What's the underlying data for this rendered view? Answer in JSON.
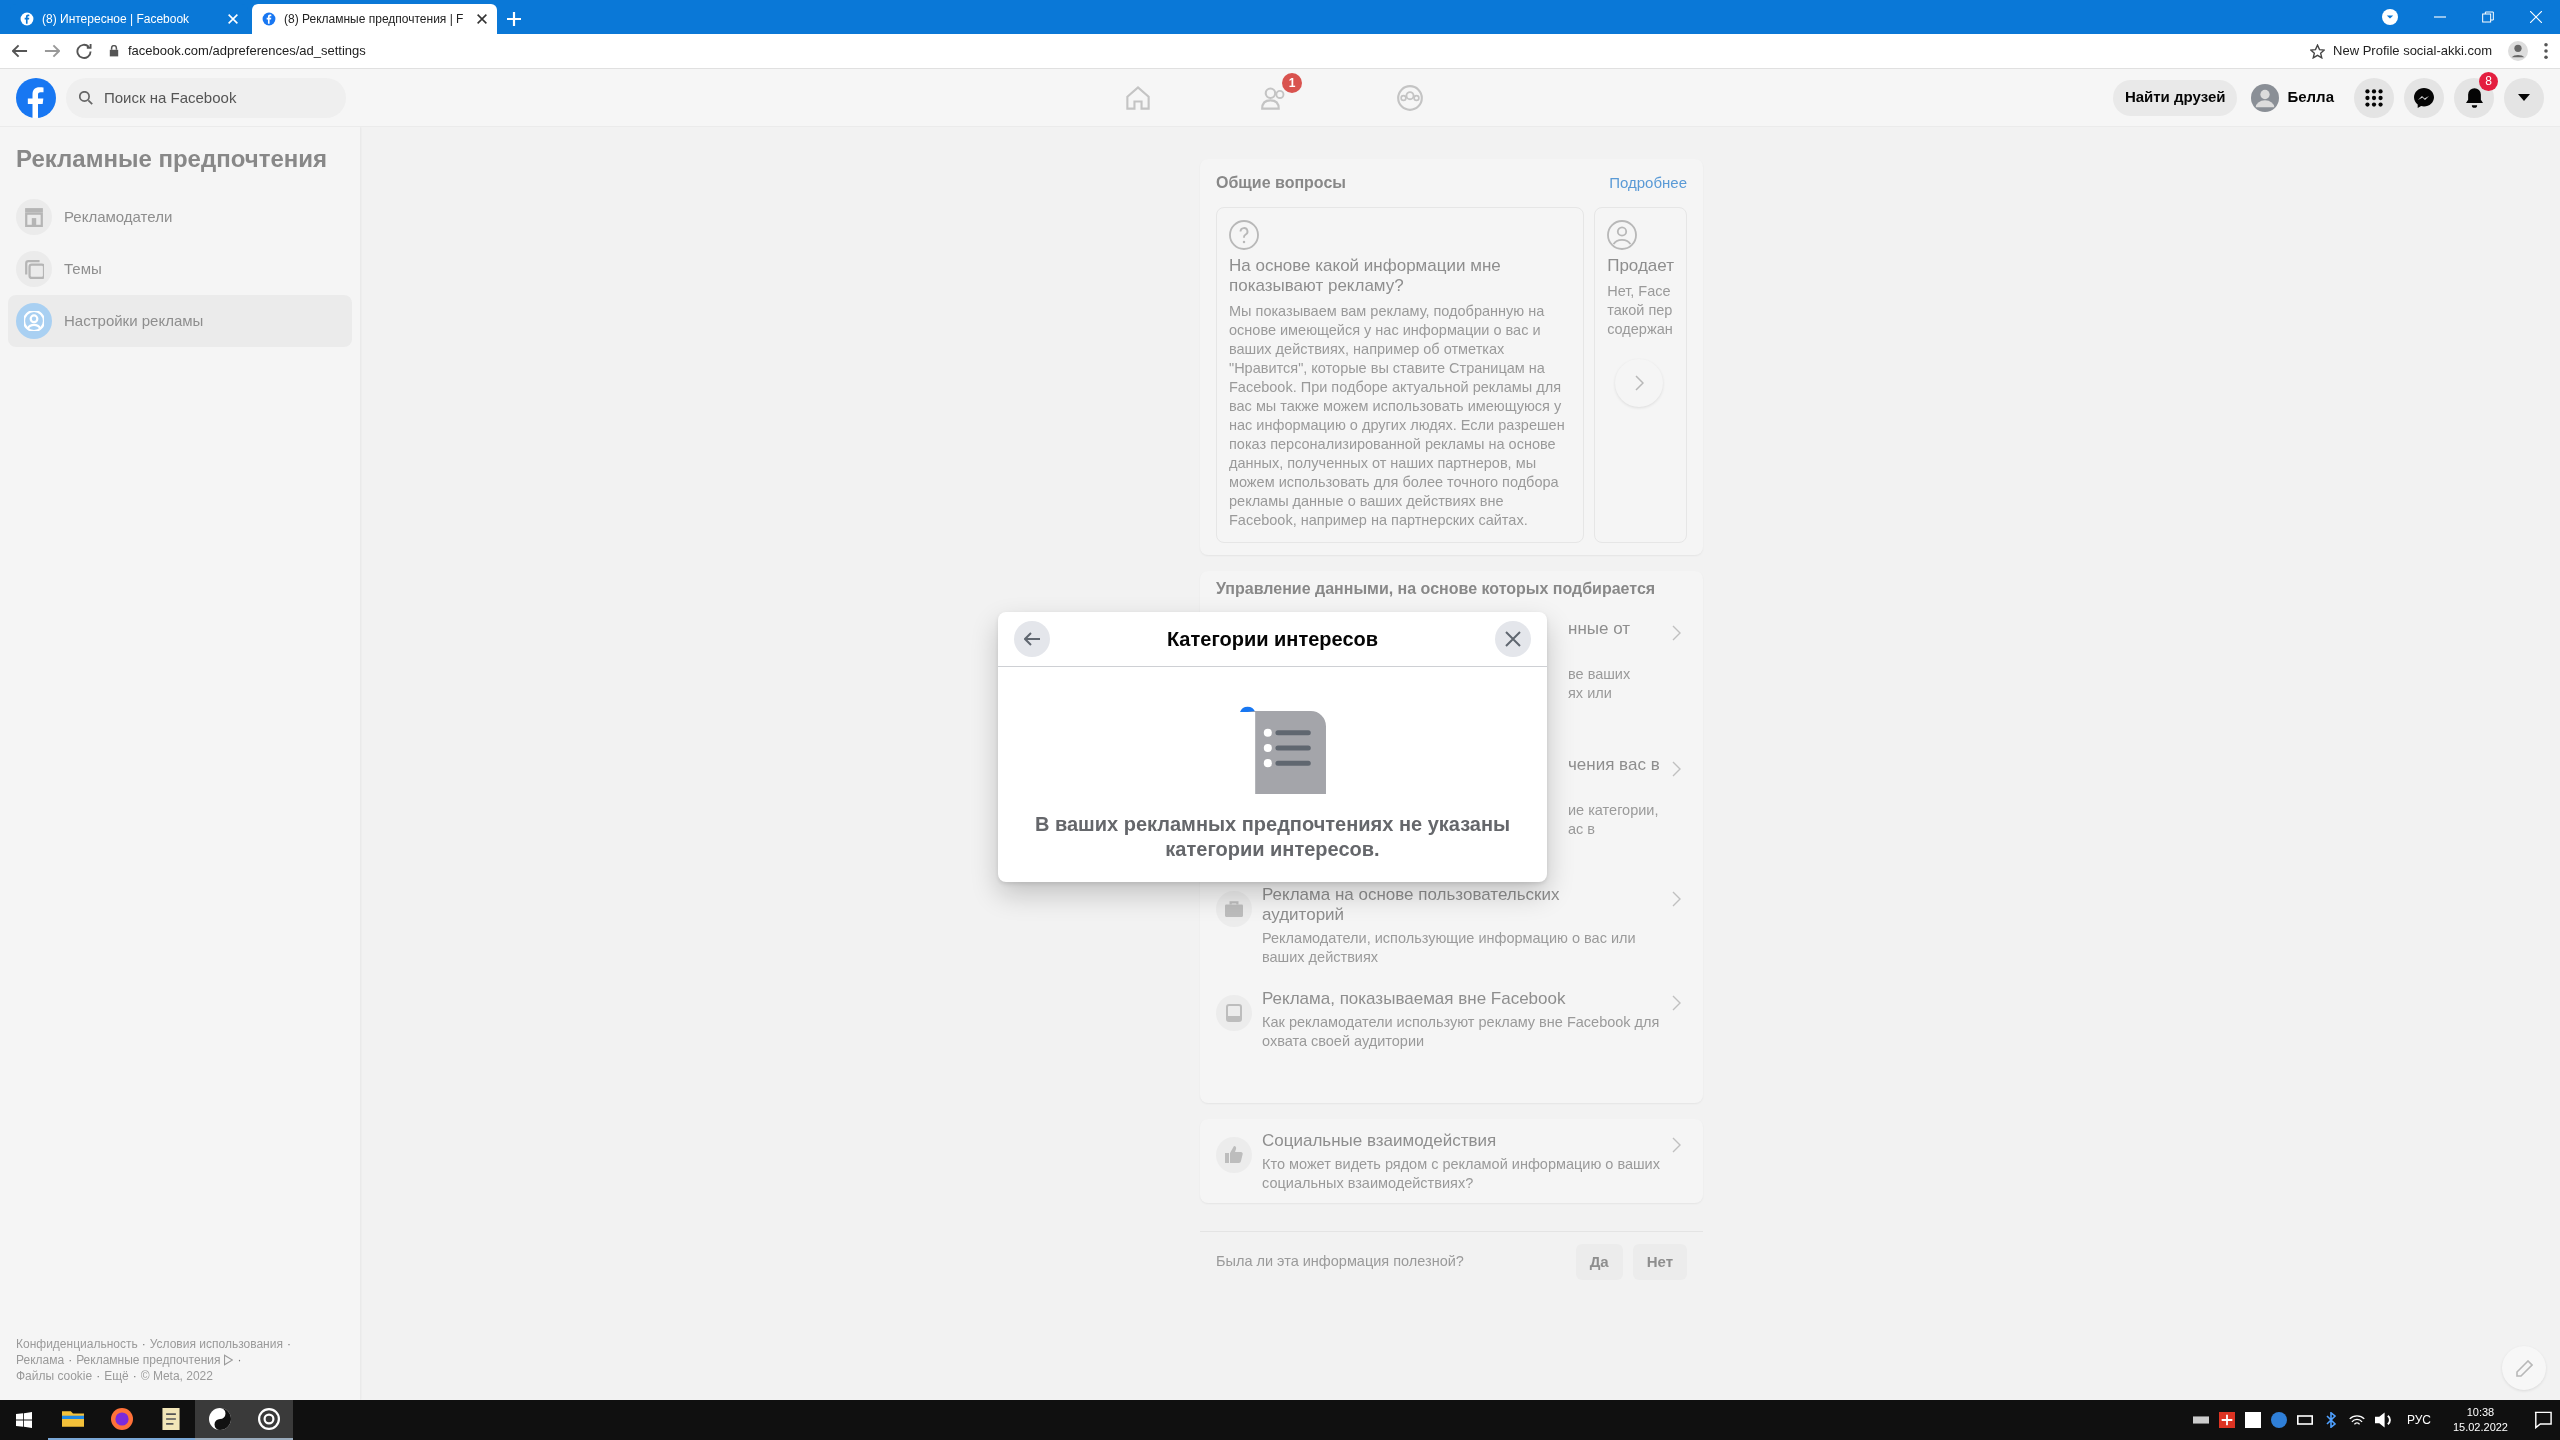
{
  "browser": {
    "tabs": [
      {
        "title": "(8) Интересное | Facebook",
        "selected": false
      },
      {
        "title": "(8) Рекламные предпочтения | F",
        "selected": true
      }
    ],
    "address": "facebook.com/adpreferences/ad_settings",
    "profile": "New Profile social-akki.com"
  },
  "header": {
    "search_placeholder": "Поиск на Facebook",
    "nav": [
      {
        "kind": "home"
      },
      {
        "kind": "friends",
        "badge": "1"
      },
      {
        "kind": "groups"
      }
    ],
    "find_friends": "Найти друзей",
    "user": "Белла",
    "notifications_badge": "8"
  },
  "sidebar": {
    "title": "Рекламные предпочтения",
    "items": [
      {
        "kind": "store",
        "label": "Рекламодатели",
        "selected": false
      },
      {
        "kind": "topics",
        "label": "Темы",
        "selected": false
      },
      {
        "kind": "settings",
        "label": "Настройки рекламы",
        "selected": true
      }
    ],
    "footer_links": [
      "Конфиденциальность",
      "Условия использования",
      "Реклама",
      "Рекламные предпочтения",
      "Файлы cookie",
      "Ещё",
      "© Meta, 2022"
    ],
    "footer_separator": "·"
  },
  "general": {
    "title": "Общие вопросы",
    "more": "Подробнее",
    "cards": [
      {
        "kind": "question",
        "title": "На основе какой информации мне показывают рекламу?",
        "body": [
          "Мы показываем вам рекламу, подобранную на основе имеющейся у нас информации о вас и ваших действиях, например об отметках \"Нравится\", которые вы ставите Страницам на Facebook. При подборе актуальной рекламы для вас мы также можем использовать имеющуюся у нас информацию о других людях. Если разрешен показ персонализированной рекламы на основе данных, полученных от наших партнеров, мы можем использовать для более точного подбора рекламы данные о ваших действиях вне Facebook, например на партнерских сайтах."
        ]
      },
      {
        "kind": "person",
        "title": "Продает",
        "body": [
          "Нет, Face",
          "такой пер",
          "содержан"
        ]
      }
    ]
  },
  "manage": {
    "title": "Управление данными, на основе которых подбирается",
    "rows": [
      {
        "kind": "hidden",
        "title": "нные от",
        "desc": [
          "ве ваших",
          "ях или"
        ]
      },
      {
        "kind": "hidden",
        "title": "чения вас в",
        "desc": [
          "ие категории,",
          "ас в"
        ]
      },
      {
        "kind": "audience",
        "title": "Реклама на основе пользовательских аудиторий",
        "desc": [
          "Рекламодатели, использующие информацию о вас или ваших действиях"
        ]
      },
      {
        "kind": "offsite",
        "title": "Реклама, показываемая вне Facebook",
        "desc": [
          "Как рекламодатели используют рекламу вне Facebook для охвата своей аудитории"
        ]
      }
    ]
  },
  "social": {
    "title": "Социальные взаимодействия",
    "desc": "Кто может видеть рядом с рекламой информацию о ваших социальных взаимодействиях?"
  },
  "feedback": {
    "question": "Была ли эта информация полезной?",
    "buttons": [
      "Да",
      "Нет"
    ]
  },
  "modal": {
    "title": "Категории интересов",
    "message": "В ваших рекламных предпочтениях не указаны категории интересов."
  },
  "taskbar": {
    "apps": [
      {
        "kind": "explorer"
      },
      {
        "kind": "firefox"
      },
      {
        "kind": "notepad"
      },
      {
        "kind": "app-dark"
      },
      {
        "kind": "app-ring"
      }
    ],
    "language": "РУС",
    "time": "10:38",
    "date": "15.02.2022"
  }
}
